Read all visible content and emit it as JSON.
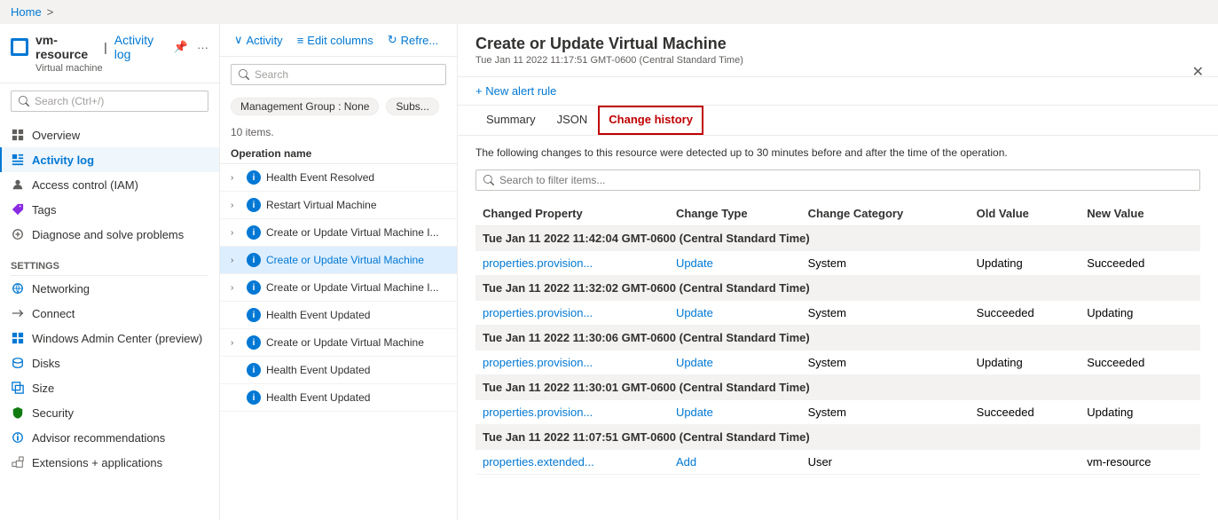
{
  "breadcrumb": {
    "home": "Home"
  },
  "sidebar": {
    "resource_icon_alt": "vm",
    "resource_name": "vm-resource",
    "resource_type": "Virtual machine",
    "page_title": "Activity log",
    "search_placeholder": "Search (Ctrl+/)",
    "nav_items": [
      {
        "id": "overview",
        "label": "Overview",
        "icon": "grid"
      },
      {
        "id": "activity-log",
        "label": "Activity log",
        "icon": "list",
        "active": true
      },
      {
        "id": "access-control",
        "label": "Access control (IAM)",
        "icon": "person"
      },
      {
        "id": "tags",
        "label": "Tags",
        "icon": "tag"
      },
      {
        "id": "diagnose",
        "label": "Diagnose and solve problems",
        "icon": "wrench"
      }
    ],
    "settings_label": "Settings",
    "settings_items": [
      {
        "id": "networking",
        "label": "Networking",
        "icon": "network"
      },
      {
        "id": "connect",
        "label": "Connect",
        "icon": "plug"
      },
      {
        "id": "windows-admin",
        "label": "Windows Admin Center (preview)",
        "icon": "windows"
      },
      {
        "id": "disks",
        "label": "Disks",
        "icon": "disk"
      },
      {
        "id": "size",
        "label": "Size",
        "icon": "resize"
      },
      {
        "id": "security",
        "label": "Security",
        "icon": "shield"
      },
      {
        "id": "advisor",
        "label": "Advisor recommendations",
        "icon": "advisor"
      },
      {
        "id": "extensions",
        "label": "Extensions + applications",
        "icon": "extension"
      }
    ]
  },
  "center_panel": {
    "toolbar": {
      "activity_label": "Activity",
      "edit_columns_label": "Edit columns",
      "refresh_label": "Refre..."
    },
    "search_placeholder": "Search",
    "filters": [
      {
        "label": "Management Group : None"
      },
      {
        "label": "Subs..."
      }
    ],
    "items_count": "10 items.",
    "op_header": "Operation name",
    "items": [
      {
        "id": 1,
        "text": "Health Event Resolved",
        "expanded": false,
        "indent": false
      },
      {
        "id": 2,
        "text": "Restart Virtual Machine",
        "expanded": false,
        "indent": false
      },
      {
        "id": 3,
        "text": "Create or Update Virtual Machine I...",
        "expanded": false,
        "indent": false
      },
      {
        "id": 4,
        "text": "Create or Update Virtual Machine",
        "expanded": false,
        "indent": false,
        "selected": true
      },
      {
        "id": 5,
        "text": "Create or Update Virtual Machine I...",
        "expanded": false,
        "indent": false
      },
      {
        "id": 6,
        "text": "Health Event Updated",
        "expanded": false,
        "indent": true
      },
      {
        "id": 7,
        "text": "Create or Update Virtual Machine",
        "expanded": false,
        "indent": false
      },
      {
        "id": 8,
        "text": "Health Event Updated",
        "expanded": false,
        "indent": true
      },
      {
        "id": 9,
        "text": "Health Event Updated",
        "expanded": false,
        "indent": true
      }
    ]
  },
  "right_panel": {
    "title": "Create or Update Virtual Machine",
    "subtitle": "Tue Jan 11 2022 11:17:51 GMT-0600 (Central Standard Time)",
    "new_alert_label": "+ New alert rule",
    "tabs": [
      {
        "id": "summary",
        "label": "Summary"
      },
      {
        "id": "json",
        "label": "JSON"
      },
      {
        "id": "change-history",
        "label": "Change history",
        "active": true
      }
    ],
    "info_text": "The following changes to this resource were detected up to 30 minutes before and after the time of the operation.",
    "filter_placeholder": "Search to filter items...",
    "table_headers": [
      "Changed Property",
      "Change Type",
      "Change Category",
      "Old Value",
      "New Value"
    ],
    "groups": [
      {
        "timestamp": "Tue Jan 11 2022 11:42:04 GMT-0600 (Central Standard Time)",
        "rows": [
          {
            "property": "properties.provision...",
            "change_type": "Update",
            "category": "System",
            "old_value": "Updating",
            "new_value": "Succeeded"
          }
        ]
      },
      {
        "timestamp": "Tue Jan 11 2022 11:32:02 GMT-0600 (Central Standard Time)",
        "rows": [
          {
            "property": "properties.provision...",
            "change_type": "Update",
            "category": "System",
            "old_value": "Succeeded",
            "new_value": "Updating"
          }
        ]
      },
      {
        "timestamp": "Tue Jan 11 2022 11:30:06 GMT-0600 (Central Standard Time)",
        "rows": [
          {
            "property": "properties.provision...",
            "change_type": "Update",
            "category": "System",
            "old_value": "Updating",
            "new_value": "Succeeded"
          }
        ]
      },
      {
        "timestamp": "Tue Jan 11 2022 11:30:01 GMT-0600 (Central Standard Time)",
        "rows": [
          {
            "property": "properties.provision...",
            "change_type": "Update",
            "category": "System",
            "old_value": "Succeeded",
            "new_value": "Updating"
          }
        ]
      },
      {
        "timestamp": "Tue Jan 11 2022 11:07:51 GMT-0600 (Central Standard Time)",
        "rows": [
          {
            "property": "properties.extended...",
            "change_type": "Add",
            "category": "User",
            "old_value": "",
            "new_value": "vm-resource"
          }
        ]
      }
    ]
  }
}
